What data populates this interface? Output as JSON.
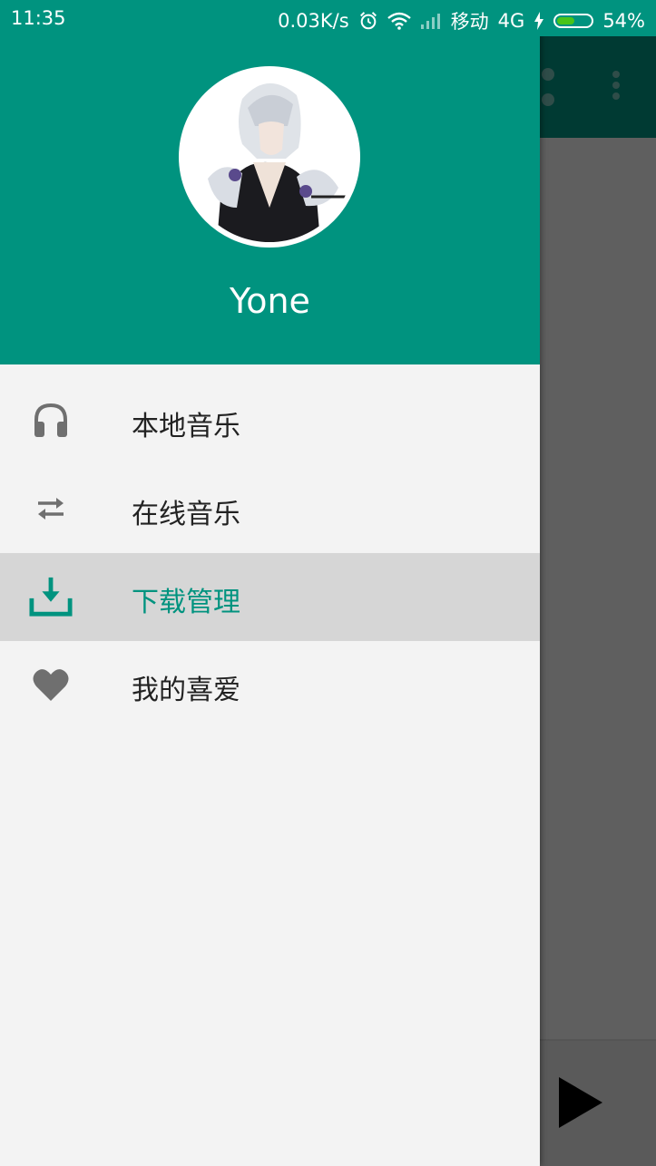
{
  "status_bar": {
    "time": "11:35",
    "net_speed": "0.03K/s",
    "carrier": "移动",
    "network": "4G",
    "battery": "54%"
  },
  "drawer": {
    "user_name": "Yone",
    "items": [
      {
        "label": "本地音乐",
        "icon": "headphones-icon",
        "selected": false
      },
      {
        "label": "在线音乐",
        "icon": "swap-arrows-icon",
        "selected": false
      },
      {
        "label": "下载管理",
        "icon": "download-icon",
        "selected": true
      },
      {
        "label": "我的喜爱",
        "icon": "heart-icon",
        "selected": false
      }
    ]
  },
  "colors": {
    "primary": "#00937f",
    "selected_bg": "#d6d6d6",
    "icon_gray": "#6f6f6f",
    "battery_green": "#48c419"
  },
  "battery_level": 0.54
}
